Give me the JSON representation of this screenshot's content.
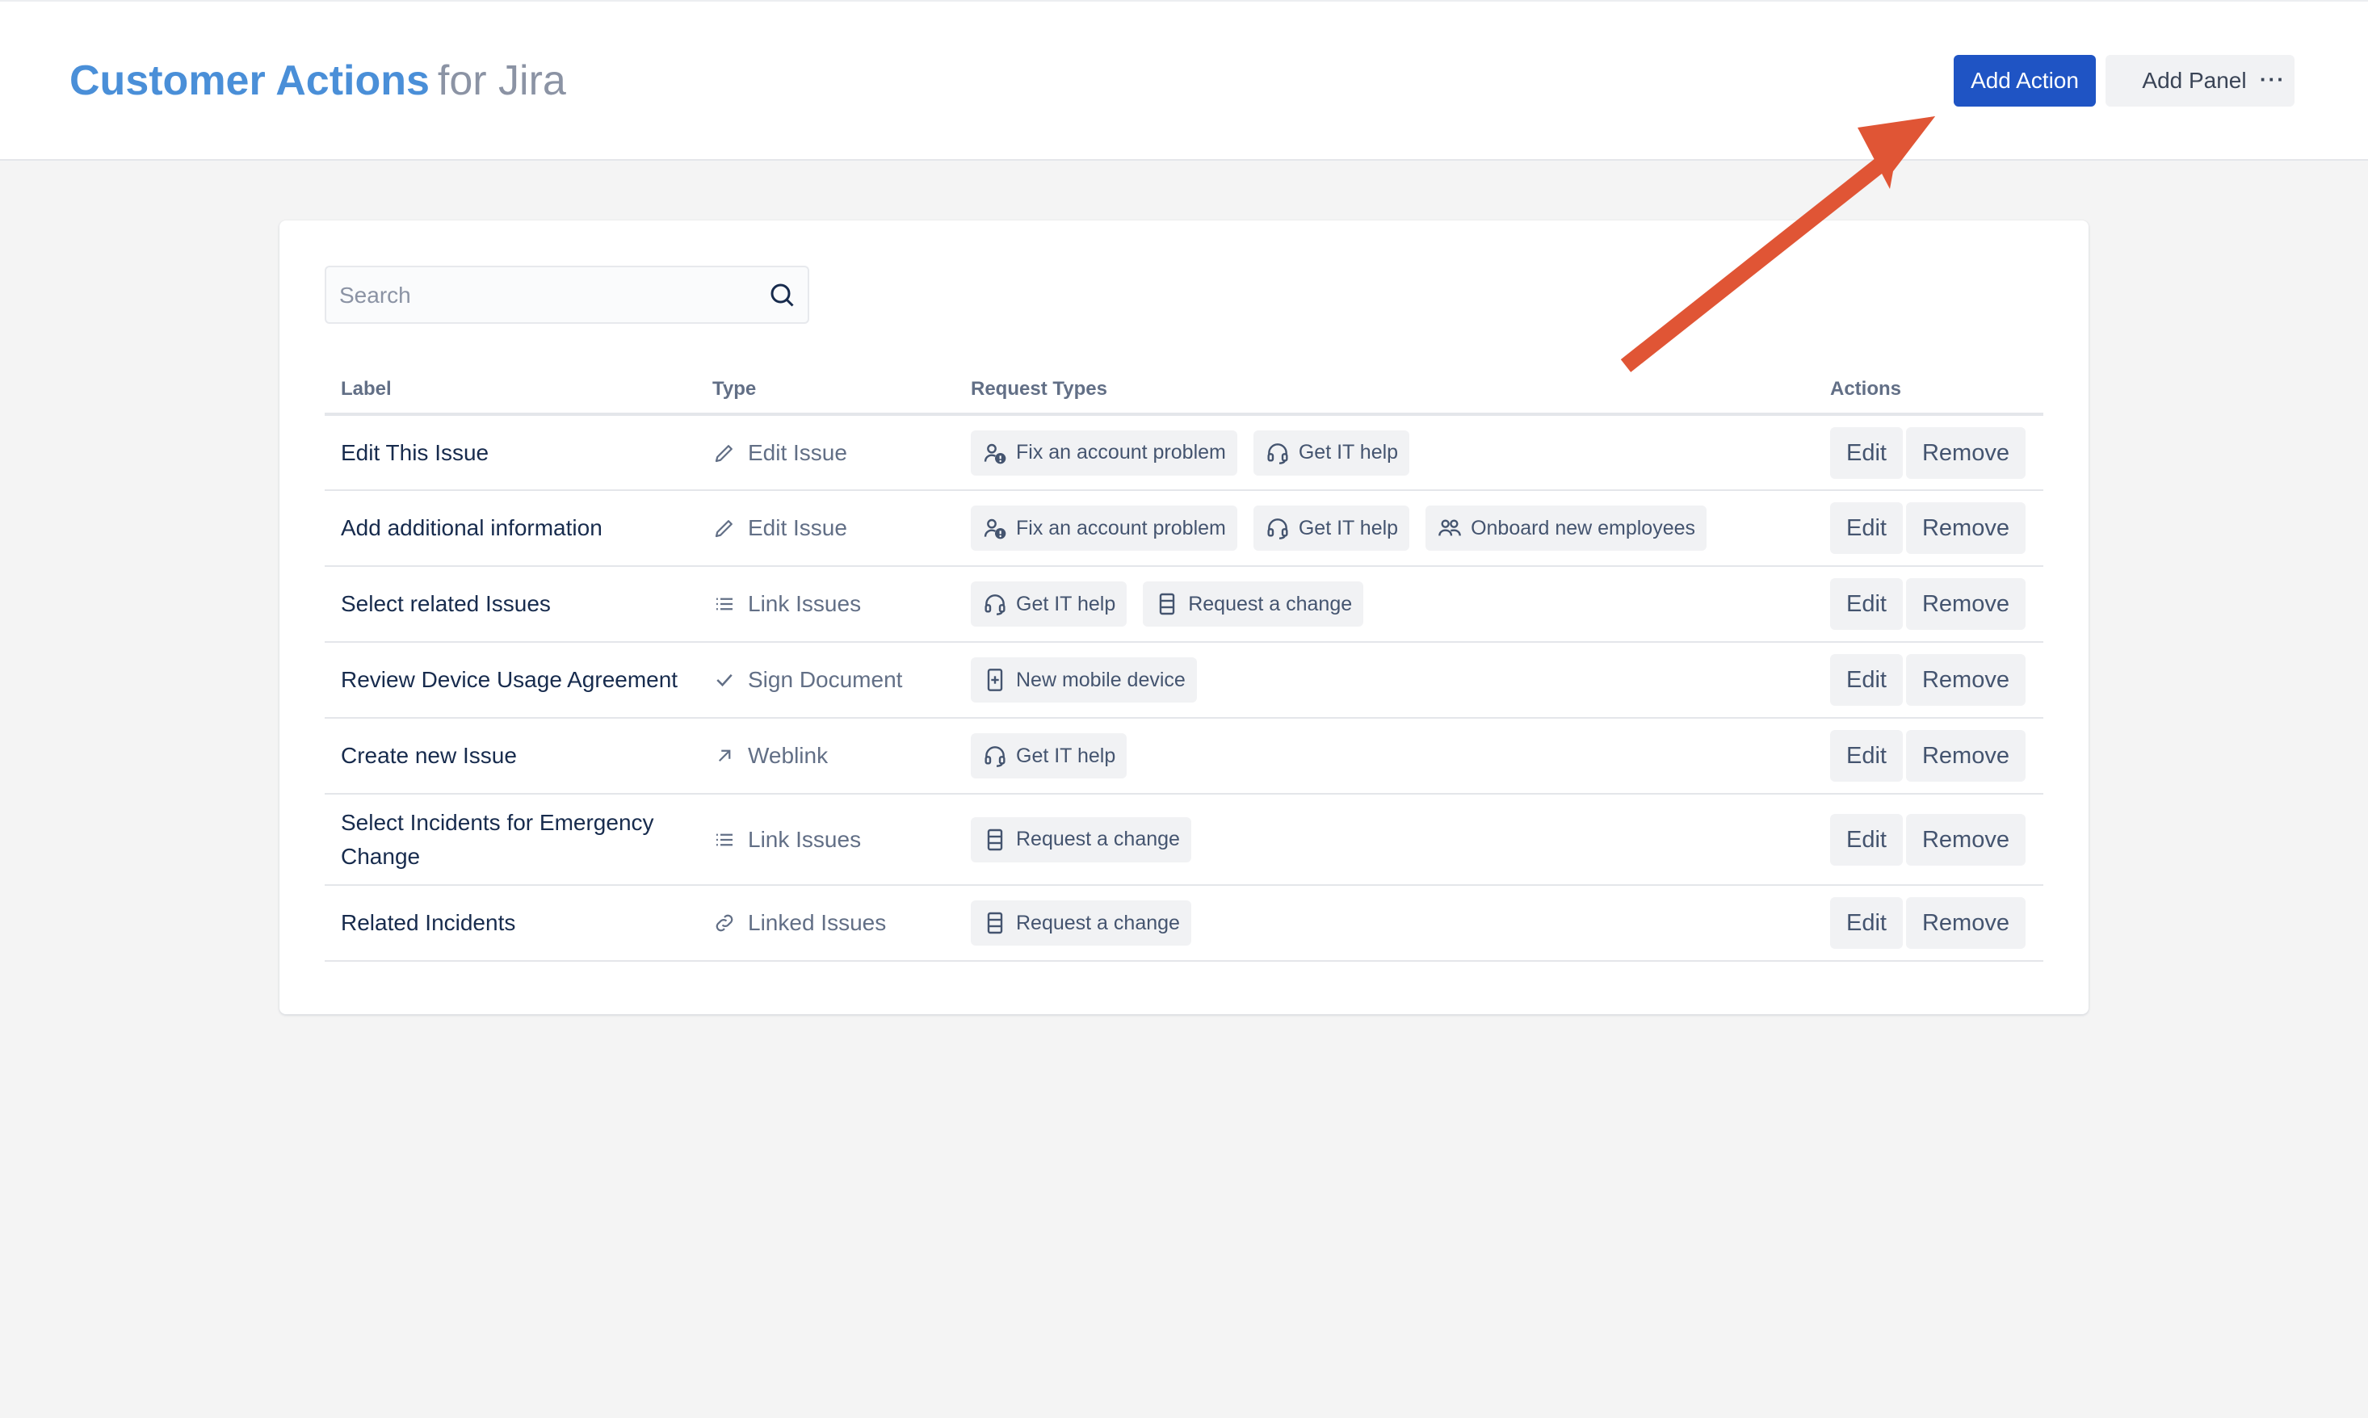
{
  "header": {
    "brand": "Customer Actions",
    "product": "for Jira",
    "add_action_label": "Add Action",
    "add_panel_label": "Add Panel",
    "more_label": "···"
  },
  "search": {
    "placeholder": "Search",
    "value": ""
  },
  "table": {
    "headers": {
      "label": "Label",
      "type": "Type",
      "request_types": "Request Types",
      "actions": "Actions"
    },
    "rows": [
      {
        "label": "Edit This Issue",
        "type": "Edit Issue",
        "type_icon": "pencil-icon",
        "request_types": [
          {
            "label": "Fix an account problem",
            "icon": "user-alert-icon"
          },
          {
            "label": "Get IT help",
            "icon": "headset-icon"
          }
        ]
      },
      {
        "label": "Add additional information",
        "type": "Edit Issue",
        "type_icon": "pencil-icon",
        "request_types": [
          {
            "label": "Fix an account problem",
            "icon": "user-alert-icon"
          },
          {
            "label": "Get IT help",
            "icon": "headset-icon"
          },
          {
            "label": "Onboard new employees",
            "icon": "people-icon"
          }
        ]
      },
      {
        "label": "Select related Issues",
        "type": "Link Issues",
        "type_icon": "list-icon",
        "request_types": [
          {
            "label": "Get IT help",
            "icon": "headset-icon"
          },
          {
            "label": "Request a change",
            "icon": "server-icon"
          }
        ]
      },
      {
        "label": "Review Device Usage Agreement",
        "type": "Sign Document",
        "type_icon": "check-icon",
        "request_types": [
          {
            "label": "New mobile device",
            "icon": "mobile-plus-icon"
          }
        ]
      },
      {
        "label": "Create new Issue",
        "type": "Weblink",
        "type_icon": "external-arrow-icon",
        "request_types": [
          {
            "label": "Get IT help",
            "icon": "headset-icon"
          }
        ]
      },
      {
        "label": "Select Incidents for Emergency Change",
        "type": "Link Issues",
        "type_icon": "list-icon",
        "request_types": [
          {
            "label": "Request a change",
            "icon": "server-icon"
          }
        ]
      },
      {
        "label": "Related Incidents",
        "type": "Linked Issues",
        "type_icon": "link-icon",
        "request_types": [
          {
            "label": "Request a change",
            "icon": "server-icon"
          }
        ]
      }
    ],
    "edit_label": "Edit",
    "remove_label": "Remove"
  },
  "colors": {
    "brand": "#4a8fd8",
    "primary_button": "#1f54c4",
    "annotation_arrow": "#e05535"
  }
}
